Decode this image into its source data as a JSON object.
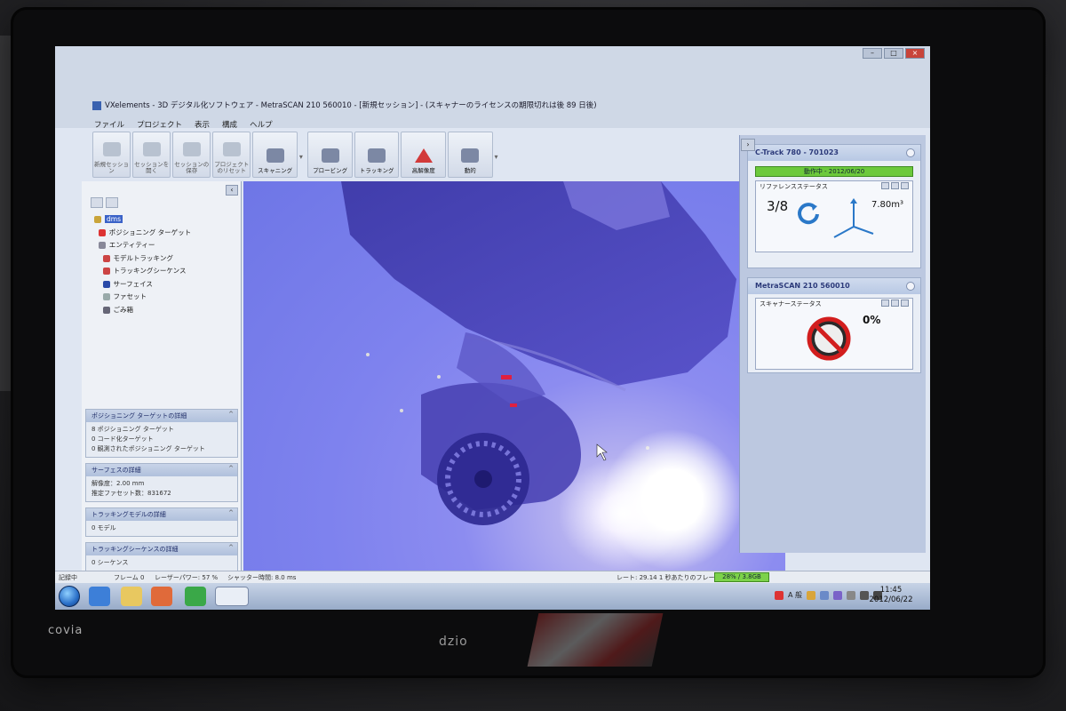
{
  "window": {
    "title": "VXelements - 3D デジタル化ソフトウェア - MetraSCAN 210 560010 - [新規セッション] - (スキャナーのライセンスの期限切れは後 89 日後)"
  },
  "menu": [
    "ファイル",
    "プロジェクト",
    "表示",
    "構成",
    "ヘルプ"
  ],
  "toolbar": [
    {
      "label": "新規セッション",
      "icon": "new-session-icon",
      "active": false
    },
    {
      "label": "セッションを開く",
      "icon": "open-session-icon",
      "active": false
    },
    {
      "label": "セッションの保存",
      "icon": "save-session-icon",
      "active": false
    },
    {
      "label": "プロジェクトのリセット",
      "icon": "reset-project-icon",
      "active": false
    },
    {
      "label": "スキャニング",
      "icon": "scanning-icon",
      "active": true
    },
    {
      "label": "プロービング",
      "icon": "probing-icon",
      "active": true
    },
    {
      "label": "トラッキング",
      "icon": "tracking-icon",
      "active": true
    },
    {
      "label": "高解像度",
      "icon": "high-resolution-icon",
      "active": true
    },
    {
      "label": "動的",
      "icon": "dynamic-icon",
      "active": true
    }
  ],
  "tree": {
    "root": "dms",
    "items": [
      "ポジショニング ターゲット",
      "エンティティー",
      "モデルトラッキング",
      "トラッキングシーケンス",
      "サーフェイス",
      "ファセット",
      "ごみ箱"
    ]
  },
  "info_boxes": [
    {
      "title": "ポジショニング ターゲットの詳細",
      "lines": [
        "8 ポジショニング ターゲット",
        "0 コード化ターゲット",
        "0 観測されたポジショニング ターゲット"
      ]
    },
    {
      "title": "サーフェスの詳細",
      "lines": [
        "解像度：2.00 mm",
        "推定ファセット数：831672"
      ]
    },
    {
      "title": "トラッキングモデルの詳細",
      "lines": [
        "0 モデル"
      ]
    },
    {
      "title": "トラッキングシーケンスの詳細",
      "lines": [
        "0 シーケンス"
      ]
    }
  ],
  "right_panel": {
    "tracker": {
      "title": "C-Track 780 - 701023",
      "status": "動作中 - 2012/06/20",
      "status_color": "#6cc93c",
      "section_title": "リファレンスステータス",
      "count": "3/8",
      "volume": "7.80m³"
    },
    "scanner": {
      "title": "MetraSCAN 210 560010",
      "section_title": "スキャナーステータス",
      "percent": "0%"
    }
  },
  "statusbar": {
    "state": "記録中",
    "frame": "フレーム 0",
    "laser": "レーザーパワー: 57 %",
    "shutter": "シャッター時間: 8.0 ms",
    "rate": "レート: 29.14 1 秒あたりのフレーム数",
    "memory": "28% / 3.8GB"
  },
  "taskbar": {
    "tray_lang": "A 般",
    "time": "11:45",
    "date": "2012/06/22"
  },
  "bezel": {
    "brand": "covia",
    "model": "dzio"
  }
}
